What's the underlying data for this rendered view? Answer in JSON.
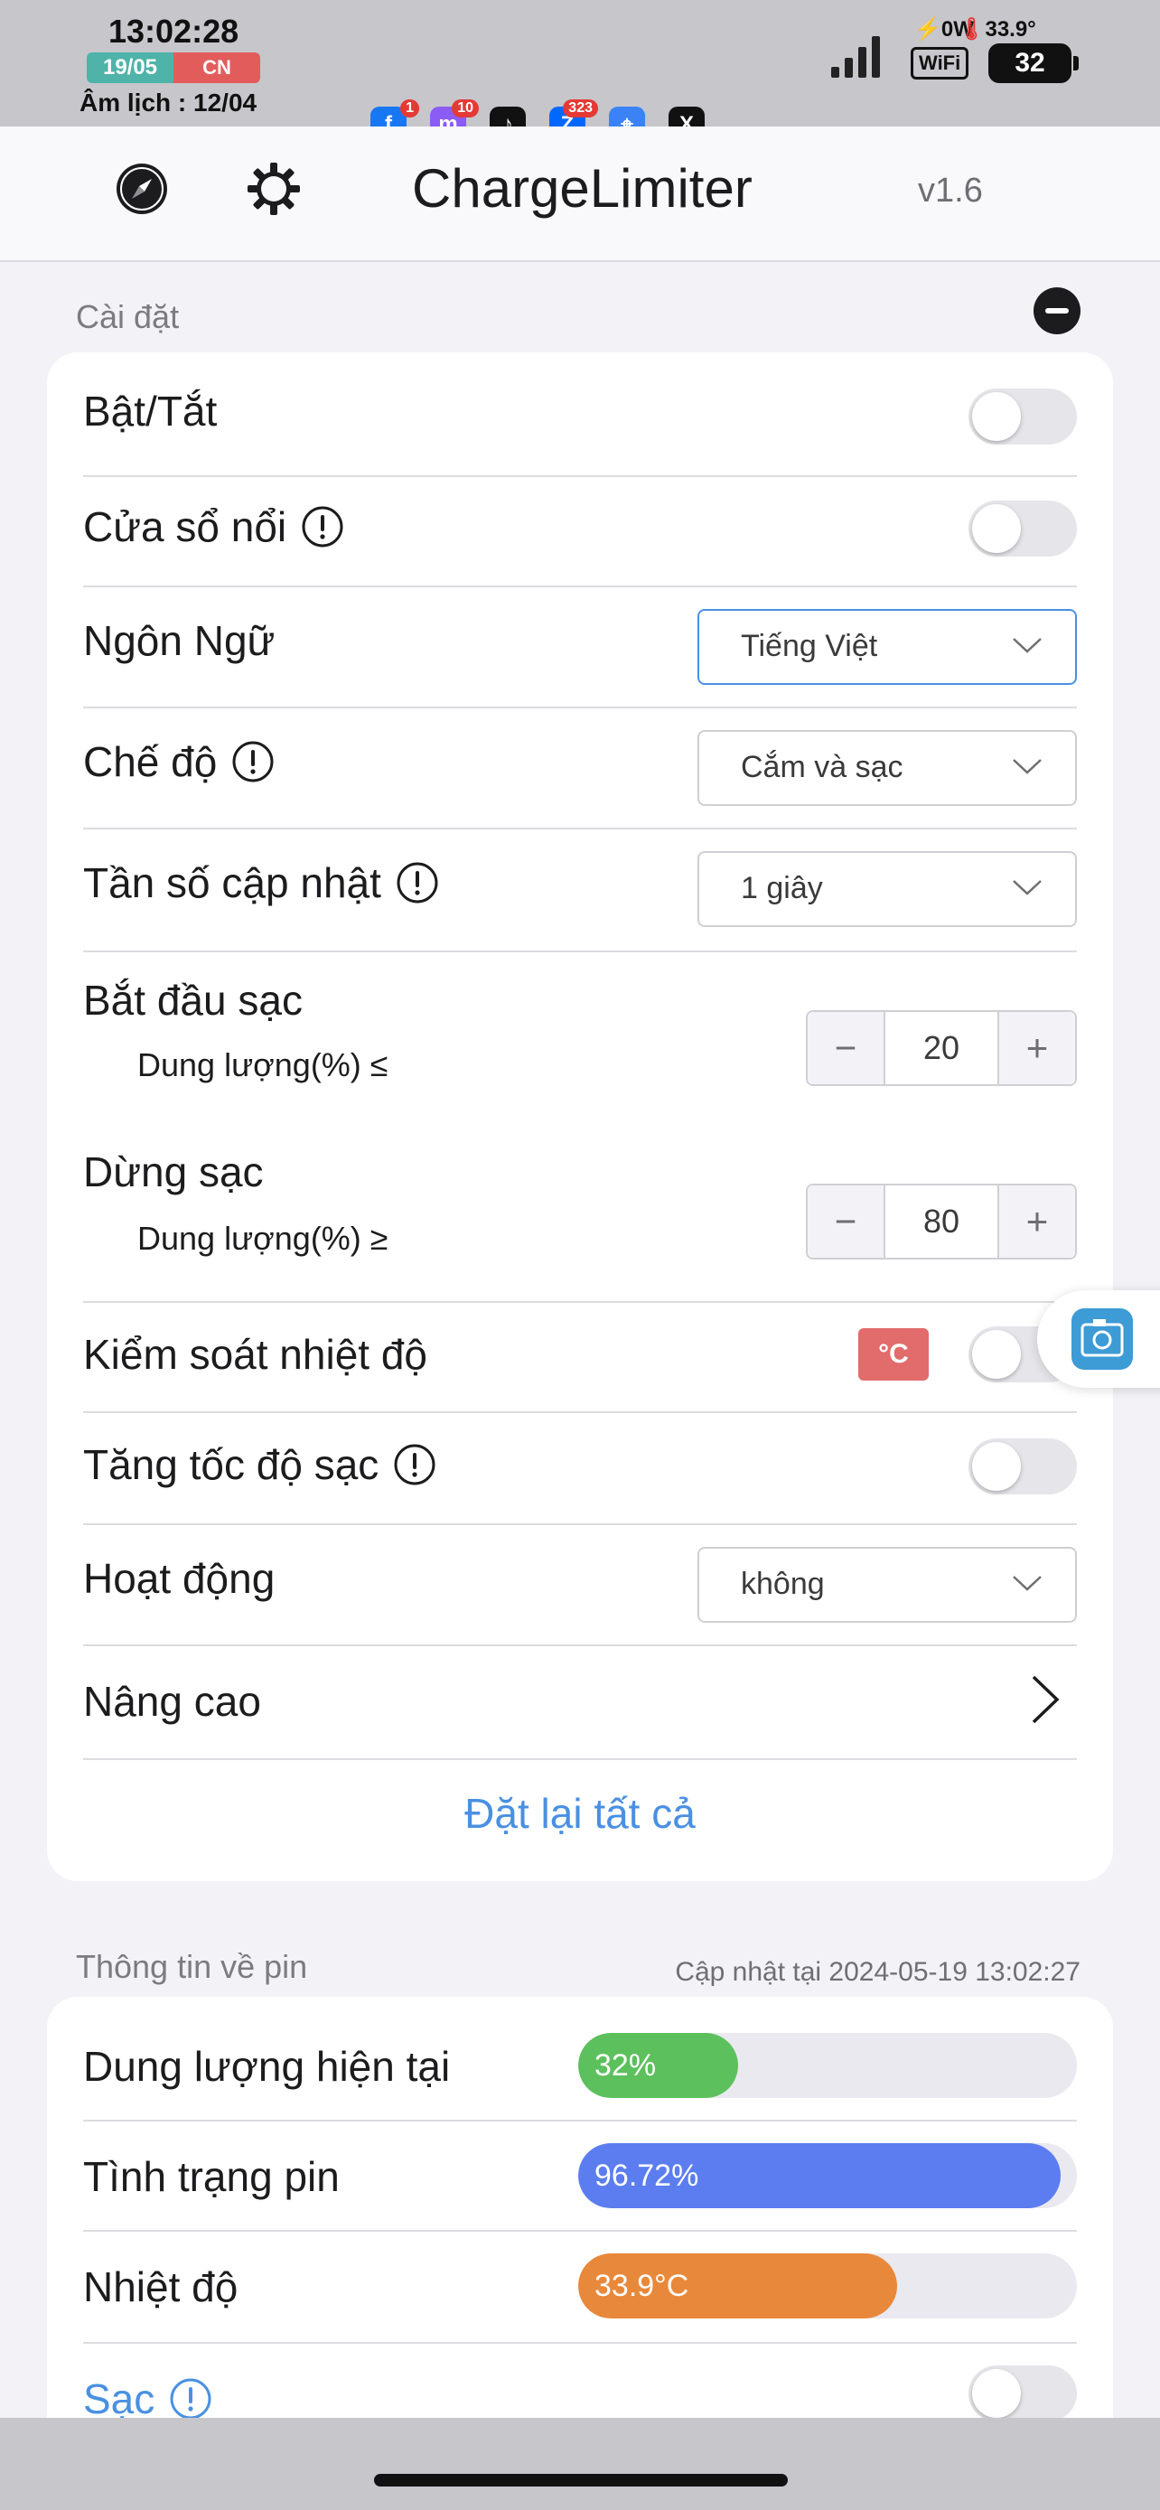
{
  "status_bar": {
    "time": "13:02:28",
    "date": "19/05",
    "day": "CN",
    "lunar": "Âm lịch : 12/04",
    "power": "0W",
    "temperature": "33.9°",
    "wifi_label": "WiFi",
    "battery": "32",
    "apps": [
      {
        "icon": "facebook-icon",
        "badge": "1",
        "color": "#1877f2"
      },
      {
        "icon": "messenger-icon",
        "badge": "10",
        "color": "#8b5cf6"
      },
      {
        "icon": "tiktok-icon",
        "badge": "",
        "color": "#111111"
      },
      {
        "icon": "zalo-icon",
        "badge": "323",
        "color": "#0068ff"
      },
      {
        "icon": "safari-icon",
        "badge": "",
        "color": "#3b82f6"
      },
      {
        "icon": "x-icon",
        "badge": "",
        "color": "#111111"
      }
    ]
  },
  "nav": {
    "title": "ChargeLimiter",
    "version": "v1.6"
  },
  "settings": {
    "section_label": "Cài đặt",
    "toggle_label": "Bật/Tắt",
    "floating_label": "Cửa sổ nổi",
    "language_label": "Ngôn Ngữ",
    "language_value": "Tiếng Việt",
    "mode_label": "Chế độ",
    "mode_value": "Cắm và sạc",
    "frequency_label": "Tần số cập nhật",
    "frequency_value": "1 giây",
    "start_label": "Bắt đầu sạc",
    "start_sub": "Dung lượng(%) ≤",
    "start_value": "20",
    "stop_label": "Dừng sạc",
    "stop_sub": "Dung lượng(%) ≥",
    "stop_value": "80",
    "temp_control_label": "Kiểm soát nhiệt độ",
    "temp_tag": "°C",
    "boost_label": "Tăng tốc độ sạc",
    "action_label": "Hoạt động",
    "action_value": "không",
    "advanced_label": "Nâng cao",
    "reset_label": "Đặt lại tất cả",
    "minus": "−",
    "plus": "+"
  },
  "battery_info": {
    "section_label": "Thông tin về pin",
    "updated": "Cập nhật tại 2024-05-19 13:02:27",
    "capacity_label": "Dung lượng hiện tại",
    "capacity_value": "32%",
    "capacity_fraction": 0.32,
    "health_label": "Tình trạng pin",
    "health_value": "96.72%",
    "health_fraction": 0.9672,
    "temperature_label": "Nhiệt độ",
    "temperature_value": "33.9°C",
    "temperature_fraction": 0.64,
    "charging_label": "Sạc"
  },
  "colors": {
    "accent": "#4a90e2",
    "capacity": "#5cc05c",
    "health": "#5b7df0",
    "temperature": "#e8883a",
    "temp_tag": "#e26b6b"
  }
}
